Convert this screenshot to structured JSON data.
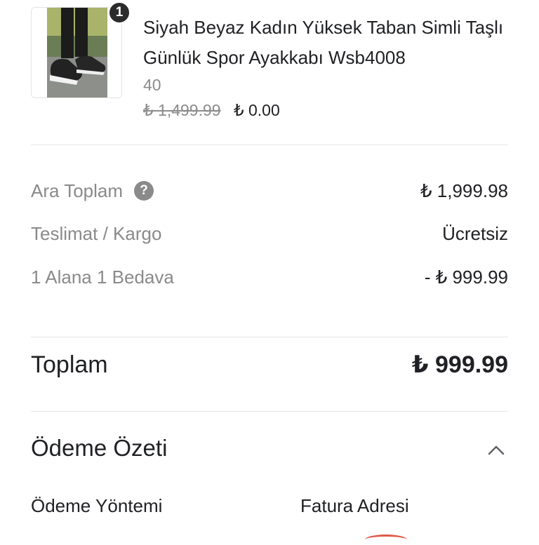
{
  "product": {
    "quantity": "1",
    "name": "Siyah Beyaz Kadın Yüksek Taban Simli Taşlı Günlük Spor Ayakkabı Wsb4008",
    "variant": "40",
    "old_price": "₺ 1,499.99",
    "price": "₺ 0.00",
    "image_icon": "sneaker-photo"
  },
  "totals": {
    "subtotal_label": "Ara Toplam",
    "subtotal_value": "₺ 1,999.98",
    "shipping_label": "Teslimat / Kargo",
    "shipping_value": "Ücretsiz",
    "discount_label": "1 Alana 1 Bedava",
    "discount_value": "- ₺ 999.99",
    "total_label": "Toplam",
    "total_value": "₺ 999.99",
    "help_glyph": "?"
  },
  "summary": {
    "title": "Ödeme Özeti",
    "payment_method_label": "Ödeme Yöntemi",
    "billing_address_label": "Fatura Adresi"
  },
  "colors": {
    "text": "#202124",
    "muted": "#8a8a8a",
    "divider": "#e6e6e6",
    "badge": "#2b2b2b"
  }
}
